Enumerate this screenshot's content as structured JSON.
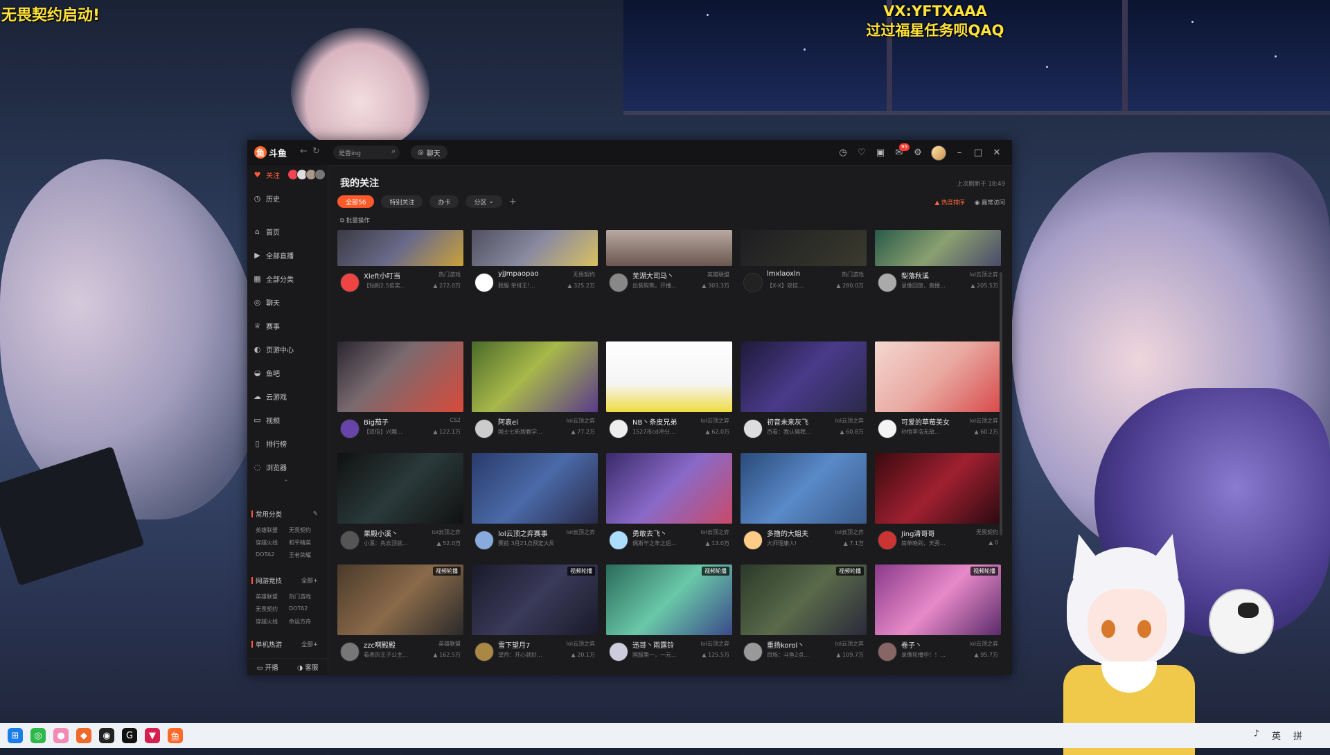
{
  "overlay": {
    "left_text": "无畏契约启动!",
    "right_line1": "VX:YFTXAAA",
    "right_line2": "过过福星任务呗QAQ"
  },
  "app": {
    "logo_text": "斗鱼",
    "search_placeholder": "是香ing",
    "chat_label": "聊天",
    "notification_count": "95"
  },
  "sidebar": {
    "follow_label": "关注",
    "history_label": "历史",
    "items": [
      {
        "label": "首页",
        "icon": "home-icon"
      },
      {
        "label": "全部直播",
        "icon": "live-icon"
      },
      {
        "label": "全部分类",
        "icon": "grid-icon"
      },
      {
        "label": "聊天",
        "icon": "chat-icon"
      },
      {
        "label": "赛事",
        "icon": "trophy-icon"
      },
      {
        "label": "页游中心",
        "icon": "game-icon"
      },
      {
        "label": "鱼吧",
        "icon": "fish-icon"
      },
      {
        "label": "云游戏",
        "icon": "cloud-game-icon"
      },
      {
        "label": "视频",
        "icon": "video-icon"
      },
      {
        "label": "排行榜",
        "icon": "rank-icon"
      },
      {
        "label": "浏览器",
        "icon": "browser-icon"
      }
    ],
    "common_title": "常用分类",
    "common_items": [
      "英雄联盟",
      "无畏契约",
      "穿越火线",
      "和平精英",
      "DOTA2",
      "王者荣耀"
    ],
    "netgame_title": "网游竞技",
    "netgame_more": "全部+",
    "netgame_items": [
      "英雄联盟",
      "热门游戏",
      "无畏契约",
      "DOTA2",
      "穿越火线",
      "命运方舟"
    ],
    "single_title": "单机热游",
    "single_more": "全部+",
    "foot_start": "开播",
    "foot_service": "客服"
  },
  "main": {
    "title": "我的关注",
    "refresh_text": "上次刷新于 18:49",
    "chips": [
      "全部56",
      "特别关注",
      "办卡",
      "分区"
    ],
    "sort_hot": "热度排序",
    "sort_recent": "最常访问",
    "batch_label": "批量操作",
    "video_tag": "视频轮播"
  },
  "cards": [
    {
      "name": "Xleft小叮当",
      "cat": "热门游戏",
      "desc": "【钻粉2.5倍奖...",
      "heat": "272.0万"
    },
    {
      "name": "yjJmpaopao",
      "cat": "无畏契约",
      "desc": "我服 单排王!...",
      "heat": "325.2万"
    },
    {
      "name": "芜湖大司马丶",
      "cat": "英雄联盟",
      "desc": "出装狗熊，开播...",
      "heat": "303.3万"
    },
    {
      "name": "lmxlaoxln",
      "cat": "热门游戏",
      "desc": "【X-X】双倍...",
      "heat": "280.0万"
    },
    {
      "name": "梨落秋溪",
      "cat": "lol云顶之弈",
      "desc": "录像回放，直播...",
      "heat": "205.5万"
    },
    {
      "name": "Big茄子",
      "cat": "CS2",
      "desc": "【双倍】兴趣...",
      "heat": "122.1万"
    },
    {
      "name": "阿袁el",
      "cat": "lol云顶之弈",
      "desc": "国士七新版教学...",
      "heat": "77.2万"
    },
    {
      "name": "NB丶条皮兄弟",
      "cat": "lol云顶之弈",
      "desc": "1527币cd冲分...",
      "heat": "62.0万"
    },
    {
      "name": "初音未来灰飞",
      "cat": "lol云顶之弈",
      "desc": "百看：我认输我...",
      "heat": "60.8万"
    },
    {
      "name": "可爱的草莓美女",
      "cat": "lol云顶之弈",
      "desc": "孙悟李浩无敌...",
      "heat": "60.2万"
    },
    {
      "name": "果殿小溪丶",
      "cat": "lol云顶之弈",
      "desc": "小溪：先云顶就...",
      "heat": "52.0万"
    },
    {
      "name": "lol云顶之弈赛事",
      "cat": "lol云顶之弈",
      "desc": "赛前 3月21点预定大局会...",
      "heat": ""
    },
    {
      "name": "勇敢去飞丶",
      "cat": "lol云顶之弈",
      "desc": "偶斯干之年之后...",
      "heat": "13.0万"
    },
    {
      "name": "多撸的大姐夫",
      "cat": "lol云顶之弈",
      "desc": "大师理康人!",
      "heat": "7.1万"
    },
    {
      "name": "Jing清哥哥",
      "cat": "无畏契约",
      "desc": "简单晚到，天秀...",
      "heat": "0"
    },
    {
      "name": "zzc啊殿殿",
      "cat": "英雄联盟",
      "desc": "看表的王子公主...",
      "heat": "162.5万"
    },
    {
      "name": "雪下望月7",
      "cat": "lol云顶之弈",
      "desc": "望月：开心就好...",
      "heat": "20.1万"
    },
    {
      "name": "迅哥丶雨露铃",
      "cat": "lol云顶之弈",
      "desc": "国服第一，一元...",
      "heat": "125.5万"
    },
    {
      "name": "重扬korol丶",
      "cat": "lol云顶之弈",
      "desc": "目场：斗鱼2点...",
      "heat": "109.7万"
    },
    {
      "name": "卷子丶",
      "cat": "lol云顶之弈",
      "desc": "录像轮播中！！...",
      "heat": "95.7万"
    }
  ],
  "taskbar": {
    "ime": "英",
    "ime2": "拼"
  },
  "colors": {
    "accent": "#ff5a2a",
    "bg": "#1b1b1d",
    "sidebar": "#19191b"
  }
}
